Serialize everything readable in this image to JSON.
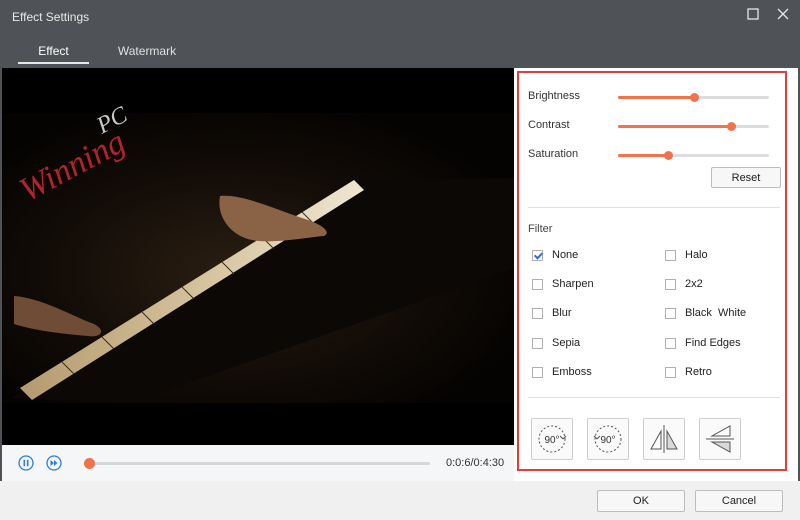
{
  "window": {
    "title": "Effect Settings"
  },
  "tabs": [
    {
      "label": "Effect",
      "active": true
    },
    {
      "label": "Watermark",
      "active": false
    }
  ],
  "video": {
    "watermark_main": "Winning",
    "watermark_sub": "PC"
  },
  "player": {
    "time": "0:0:6/0:4:30",
    "progress_fraction": 0.0
  },
  "adjust": {
    "brightness": {
      "label": "Brightness",
      "value": 0.5
    },
    "contrast": {
      "label": "Contrast",
      "value": 0.75
    },
    "saturation": {
      "label": "Saturation",
      "value": 0.33
    },
    "reset_label": "Reset"
  },
  "filter": {
    "title": "Filter",
    "items": [
      {
        "label": "None",
        "checked": true
      },
      {
        "label": "Halo",
        "checked": false
      },
      {
        "label": "Sharpen",
        "checked": false
      },
      {
        "label": "2x2",
        "checked": false
      },
      {
        "label": "Blur",
        "checked": false
      },
      {
        "label": "Black  White",
        "checked": false
      },
      {
        "label": "Sepia",
        "checked": false
      },
      {
        "label": "Find Edges",
        "checked": false
      },
      {
        "label": "Emboss",
        "checked": false
      },
      {
        "label": "Retro",
        "checked": false
      }
    ]
  },
  "rotate": {
    "cw_label": "90°",
    "ccw_label": "90°"
  },
  "footer": {
    "ok_label": "OK",
    "cancel_label": "Cancel"
  },
  "colors": {
    "accent": "#f0734b",
    "highlight_border": "#e23c3c"
  }
}
